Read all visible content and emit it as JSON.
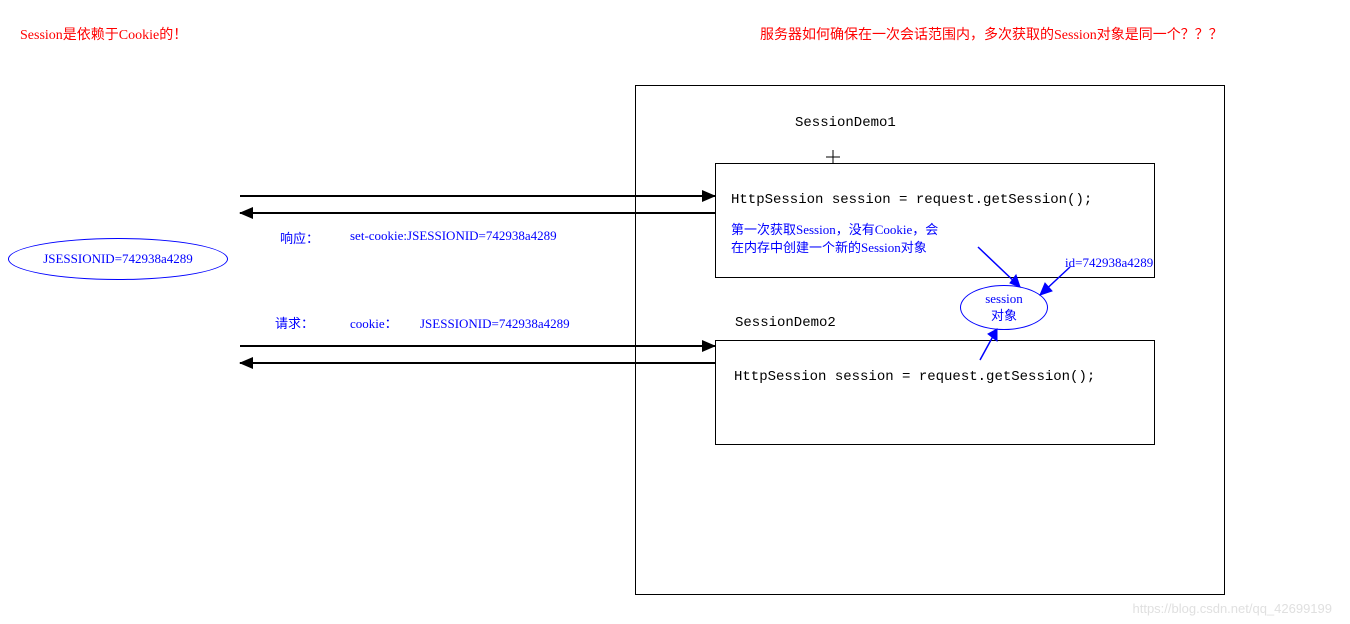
{
  "title_left": "Session是依赖于Cookie的！",
  "title_right": "服务器如何确保在一次会话范围内，多次获取的Session对象是同一个？？？",
  "client_cookie": "JSESSIONID=742938a4289",
  "response_label": "响应：",
  "response_cookie": "set-cookie:JSESSIONID=742938a4289",
  "request_label": "请求：",
  "request_cookie_prefix": "cookie：",
  "request_cookie_value": "JSESSIONID=742938a4289",
  "demo1_title": "SessionDemo1",
  "demo1_code": "HttpSession session = request.getSession();",
  "demo1_note_line1": "第一次获取Session，没有Cookie，会",
  "demo1_note_line2": "在内存中创建一个新的Session对象",
  "demo2_title": "SessionDemo2",
  "demo2_code": "HttpSession session = request.getSession();",
  "session_obj_line1": "session",
  "session_obj_line2": "对象",
  "session_id": "id=742938a4289",
  "watermark": "https://blog.csdn.net/qq_42699199"
}
